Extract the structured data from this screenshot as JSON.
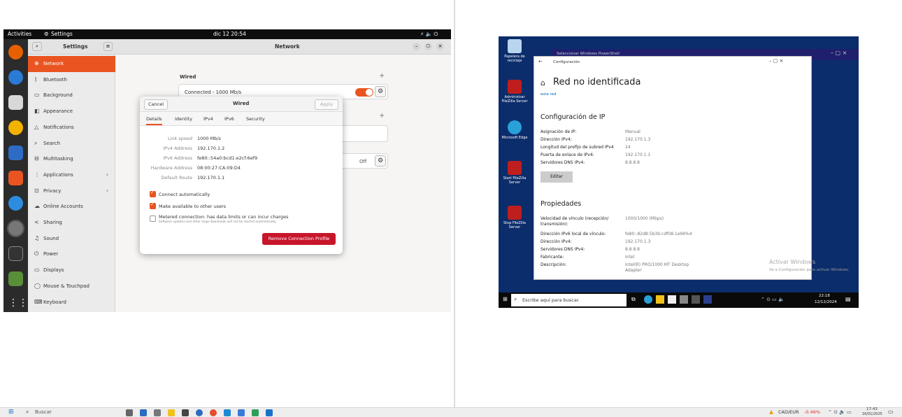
{
  "ubuntu": {
    "topbar": {
      "activities": "Activities",
      "app": "Settings",
      "clock": "dic 12  20:54"
    },
    "sidebar": {
      "title": "Settings",
      "items": [
        {
          "label": "Network",
          "icon": "network-icon"
        },
        {
          "label": "Bluetooth",
          "icon": "bluetooth-icon"
        },
        {
          "label": "Background",
          "icon": "background-icon"
        },
        {
          "label": "Appearance",
          "icon": "appearance-icon"
        },
        {
          "label": "Notifications",
          "icon": "bell-icon"
        },
        {
          "label": "Search",
          "icon": "search-icon"
        },
        {
          "label": "Multitasking",
          "icon": "multitasking-icon"
        },
        {
          "label": "Applications",
          "icon": "apps-icon"
        },
        {
          "label": "Privacy",
          "icon": "lock-icon"
        },
        {
          "label": "Online Accounts",
          "icon": "cloud-icon"
        },
        {
          "label": "Sharing",
          "icon": "share-icon"
        },
        {
          "label": "Sound",
          "icon": "music-note-icon"
        },
        {
          "label": "Power",
          "icon": "power-icon"
        },
        {
          "label": "Displays",
          "icon": "display-icon"
        },
        {
          "label": "Mouse & Touchpad",
          "icon": "mouse-icon"
        },
        {
          "label": "Keyboard",
          "icon": "keyboard-icon"
        }
      ]
    },
    "content": {
      "title": "Network",
      "wired_heading": "Wired",
      "wired_status": "Connected - 1000 Mb/s",
      "off_label": "Off"
    },
    "dialog": {
      "cancel": "Cancel",
      "title": "Wired",
      "apply": "Apply",
      "tabs": [
        "Details",
        "Identity",
        "IPv4",
        "IPv6",
        "Security"
      ],
      "details": [
        {
          "key": "Link speed",
          "value": "1000 Mb/s"
        },
        {
          "key": "IPv4 Address",
          "value": "192.170.1.2"
        },
        {
          "key": "IPv6 Address",
          "value": "fe80::54a0:bcd1:e2cf:6ef9"
        },
        {
          "key": "Hardware Address",
          "value": "08:00:27:CA:09:D4"
        },
        {
          "key": "Default Route",
          "value": "192.170.1.1"
        }
      ],
      "connect_auto": "Connect automatically",
      "available_others": "Make available to other users",
      "metered": "Metered connection: has data limits or can incur charges",
      "metered_sub": "Software updates and other large downloads will not be started automatically.",
      "remove": "Remove Connection Profile"
    }
  },
  "windows": {
    "desktop_icons": [
      {
        "label": "Papelera de reciclaje"
      },
      {
        "label": "Administrar FileZilla Server"
      },
      {
        "label": "Microsoft Edge"
      },
      {
        "label": "Start FileZilla Server"
      },
      {
        "label": "Stop FileZilla Server"
      }
    ],
    "ps_title": "Seleccionar Windows PowerShell",
    "config": {
      "window_title": "Configuración",
      "heading": "Red no identificada",
      "subtitle": "esta red",
      "ip_section": "Configuración de IP",
      "ip_rows": [
        {
          "k": "Asignación de IP:",
          "v": "Manual"
        },
        {
          "k": "Dirección IPv4:",
          "v": "192.170.1.3"
        },
        {
          "k": "Longitud del prefijo de subred IPv4",
          "v": "24"
        },
        {
          "k": "Puerta de enlace de IPv4:",
          "v": "192.170.1.1"
        },
        {
          "k": "Servidores DNS IPv4:",
          "v": "8.8.8.8"
        }
      ],
      "edit": "Editar",
      "props_section": "Propiedades",
      "prop_rows": [
        {
          "k": "Velocidad de vínculo (recepción/ transmisión):",
          "v": "1000/1000 (Mbps)"
        },
        {
          "k": "Dirección IPv6 local de vínculo:",
          "v": "fe80::82d8:5b3b:cdf08:1e96%4"
        },
        {
          "k": "Dirección IPv4:",
          "v": "192.170.1.3"
        },
        {
          "k": "Servidores DNS IPv4:",
          "v": "8.8.8.8"
        },
        {
          "k": "Fabricante:",
          "v": "Intel"
        },
        {
          "k": "Descripción:",
          "v": "Intel(R) PRO/1000 MT Desktop Adapter"
        }
      ]
    },
    "activate": {
      "title": "Activar Windows",
      "sub": "Ve a Configuración para activar Windows."
    },
    "taskbar": {
      "search": "Escribe aquí para buscar.",
      "time": "22:18",
      "date": "12/12/2024"
    }
  },
  "host": {
    "search": "Buscar",
    "currency": "CAD/EUR",
    "change": "-0.49%",
    "time": "17:43",
    "date": "16/01/2025"
  }
}
